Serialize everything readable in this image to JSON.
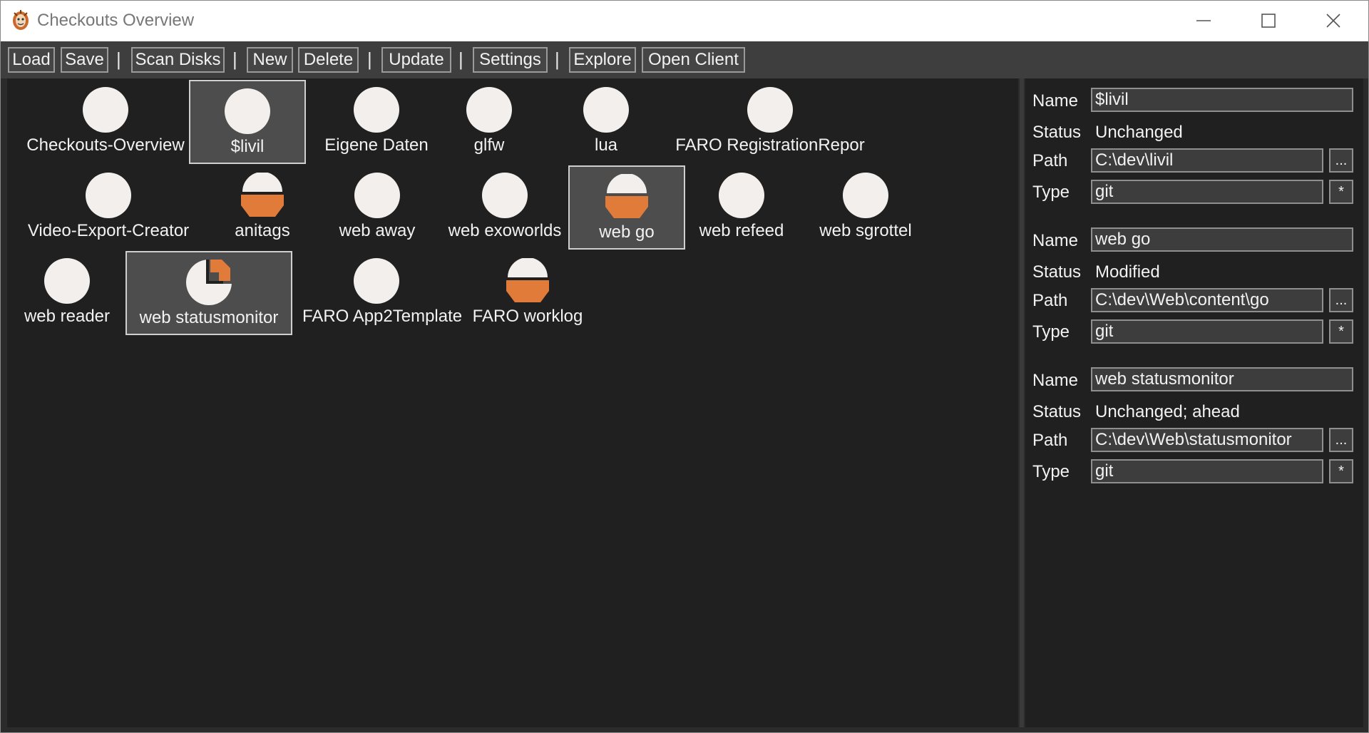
{
  "window": {
    "title": "Checkouts Overview"
  },
  "toolbar": {
    "load": "Load",
    "save": "Save",
    "scan_disks": "Scan Disks",
    "new": "New",
    "delete": "Delete",
    "update": "Update",
    "settings": "Settings",
    "explore": "Explore",
    "open_client": "Open Client",
    "separator": "|"
  },
  "colors": {
    "accent": "#e07b39",
    "icon_fill": "#f2efec",
    "background": "#202020"
  },
  "items": [
    {
      "label": "Checkouts-Overview",
      "icon": "circle-unchanged-icon",
      "selected": false
    },
    {
      "label": "$livil",
      "icon": "circle-unchanged-icon",
      "selected": true
    },
    {
      "label": "Eigene Daten",
      "icon": "circle-unchanged-icon",
      "selected": false
    },
    {
      "label": "glfw",
      "icon": "circle-unchanged-icon",
      "selected": false
    },
    {
      "label": "lua",
      "icon": "circle-unchanged-icon",
      "selected": false
    },
    {
      "label": "FARO RegistrationRepor",
      "icon": "circle-unchanged-icon",
      "selected": false
    },
    {
      "label": "Video-Export-Creator",
      "icon": "circle-unchanged-icon",
      "selected": false
    },
    {
      "label": "anitags",
      "icon": "bowl-modified-icon",
      "selected": false
    },
    {
      "label": "web away",
      "icon": "circle-unchanged-icon",
      "selected": false
    },
    {
      "label": "web exoworlds",
      "icon": "circle-unchanged-icon",
      "selected": false
    },
    {
      "label": "web go",
      "icon": "bowl-modified-icon",
      "selected": true
    },
    {
      "label": "web refeed",
      "icon": "circle-unchanged-icon",
      "selected": false
    },
    {
      "label": "web sgrottel",
      "icon": "circle-unchanged-icon",
      "selected": false
    },
    {
      "label": "web reader",
      "icon": "circle-unchanged-icon",
      "selected": false
    },
    {
      "label": "web statusmonitor",
      "icon": "circle-ahead-icon",
      "selected": true
    },
    {
      "label": "FARO App2Template",
      "icon": "circle-unchanged-icon",
      "selected": false
    },
    {
      "label": "FARO worklog",
      "icon": "bowl-modified-icon",
      "selected": false
    }
  ],
  "properties": {
    "labels": {
      "name": "Name",
      "status": "Status",
      "path": "Path",
      "type": "Type"
    },
    "browse_label": "...",
    "type_button_label": "*",
    "entries": [
      {
        "name": "$livil",
        "status": "Unchanged",
        "path": "C:\\dev\\livil",
        "type": "git"
      },
      {
        "name": "web go",
        "status": "Modified",
        "path": "C:\\dev\\Web\\content\\go",
        "type": "git"
      },
      {
        "name": "web statusmonitor",
        "status": "Unchanged; ahead",
        "path": "C:\\dev\\Web\\statusmonitor",
        "type": "git"
      }
    ]
  }
}
